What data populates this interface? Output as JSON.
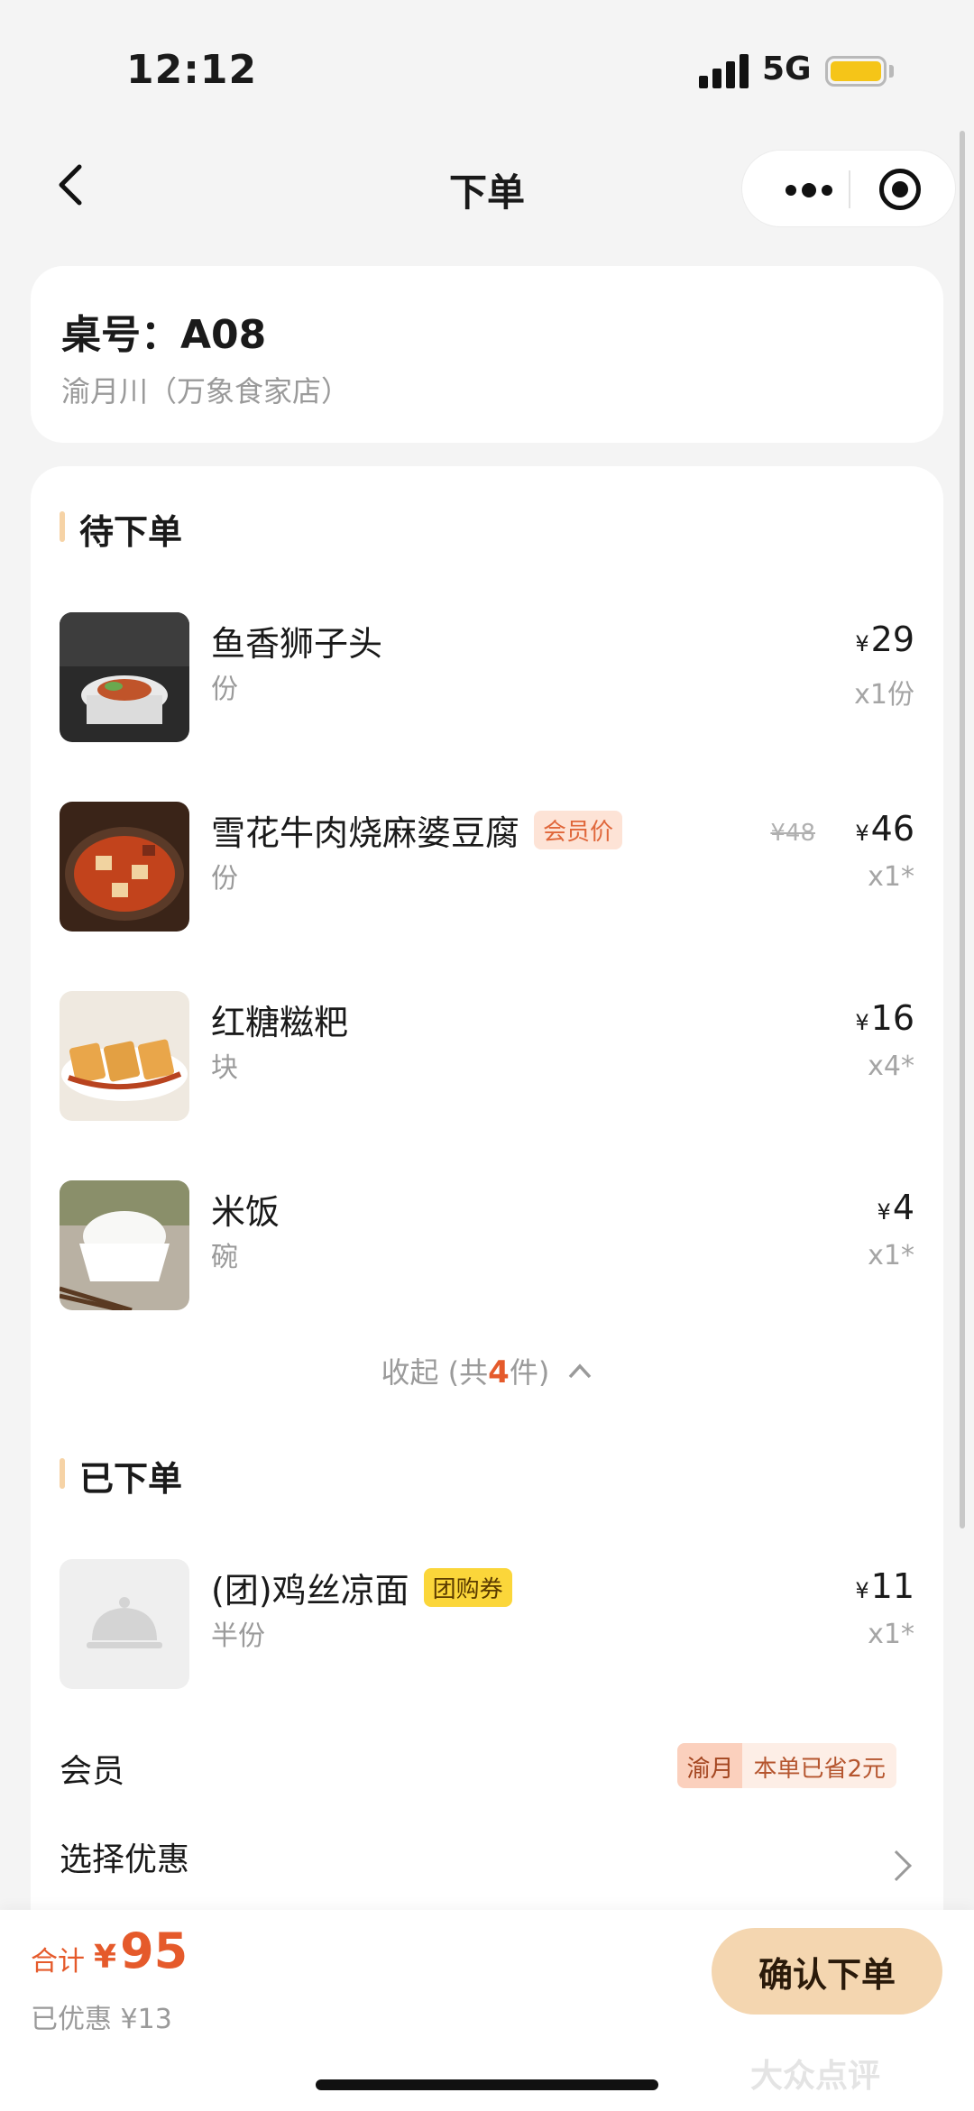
{
  "status_bar": {
    "time": "12:12",
    "network": "5G"
  },
  "nav": {
    "title": "下单"
  },
  "table": {
    "number": "桌号：A08",
    "store": "渝月川（万象食家店）"
  },
  "pending_section": {
    "title": "待下单",
    "items": [
      {
        "name": "鱼香狮子头",
        "unit": "份",
        "price": "29",
        "qty": "x1份"
      },
      {
        "name": "雪花牛肉烧麻婆豆腐",
        "tag": "会员价",
        "unit": "份",
        "old_price": "¥48",
        "price": "46",
        "qty": "x1*"
      },
      {
        "name": "红糖糍粑",
        "unit": "块",
        "price": "16",
        "qty": "x4*"
      },
      {
        "name": "米饭",
        "unit": "碗",
        "price": "4",
        "qty": "x1*"
      }
    ],
    "collapse": {
      "prefix": "收起 (共",
      "count": "4",
      "suffix": "件)"
    }
  },
  "ordered_section": {
    "title": "已下单",
    "items": [
      {
        "name": "(团)鸡丝凉面",
        "tag": "团购券",
        "unit": "半份",
        "price": "11",
        "qty": "x1*"
      }
    ]
  },
  "member": {
    "label": "会员",
    "badge_brand": "渝月",
    "badge_text": "本单已省2元"
  },
  "discount_select": {
    "label": "选择优惠"
  },
  "currency": "¥",
  "bottom": {
    "total_label": "合计",
    "total_value": "95",
    "discount_text": "已优惠 ¥13",
    "confirm_label": "确认下单"
  },
  "watermark": "大众点评",
  "colors": {
    "accent": "#e55a2b",
    "button": "#f4d6b0",
    "member_tag": "#fde3d6",
    "group_tag": "#fbd63a"
  }
}
